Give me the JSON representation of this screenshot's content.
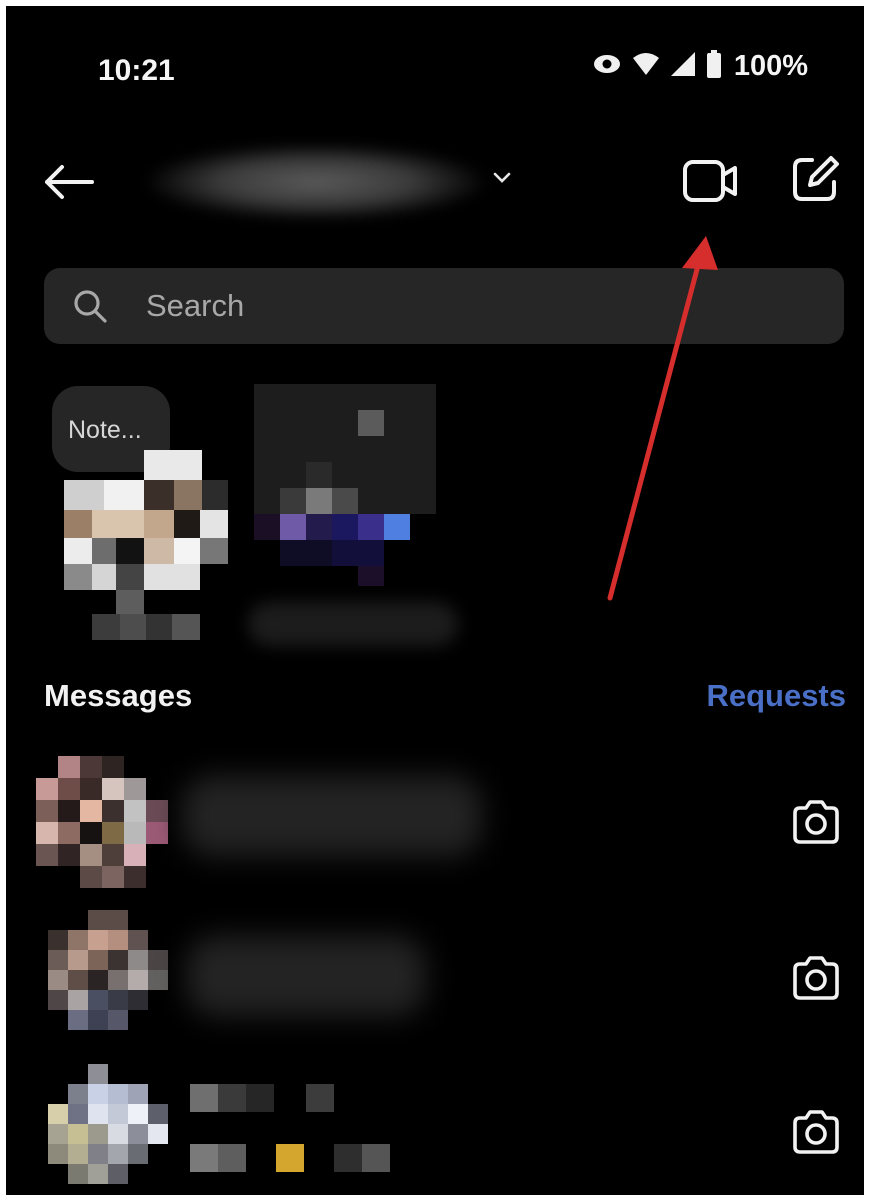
{
  "status_bar": {
    "time": "10:21",
    "battery": "100%",
    "icons": [
      "eye-icon",
      "wifi-icon",
      "signal-icon",
      "battery-icon"
    ]
  },
  "header": {
    "back_icon": "arrow-left-icon",
    "chevron_icon": "chevron-down-icon",
    "video_icon": "video-camera-icon",
    "compose_icon": "edit-icon"
  },
  "search": {
    "placeholder": "Search",
    "icon": "search-icon"
  },
  "notes": {
    "bubble_text": "Note..."
  },
  "messages": {
    "heading": "Messages",
    "requests_label": "Requests",
    "row_icon": "camera-icon"
  },
  "colors": {
    "background": "#000000",
    "search_bg": "#262626",
    "requests_link": "#4a6fc7",
    "annotation_arrow": "#d62d2d"
  }
}
